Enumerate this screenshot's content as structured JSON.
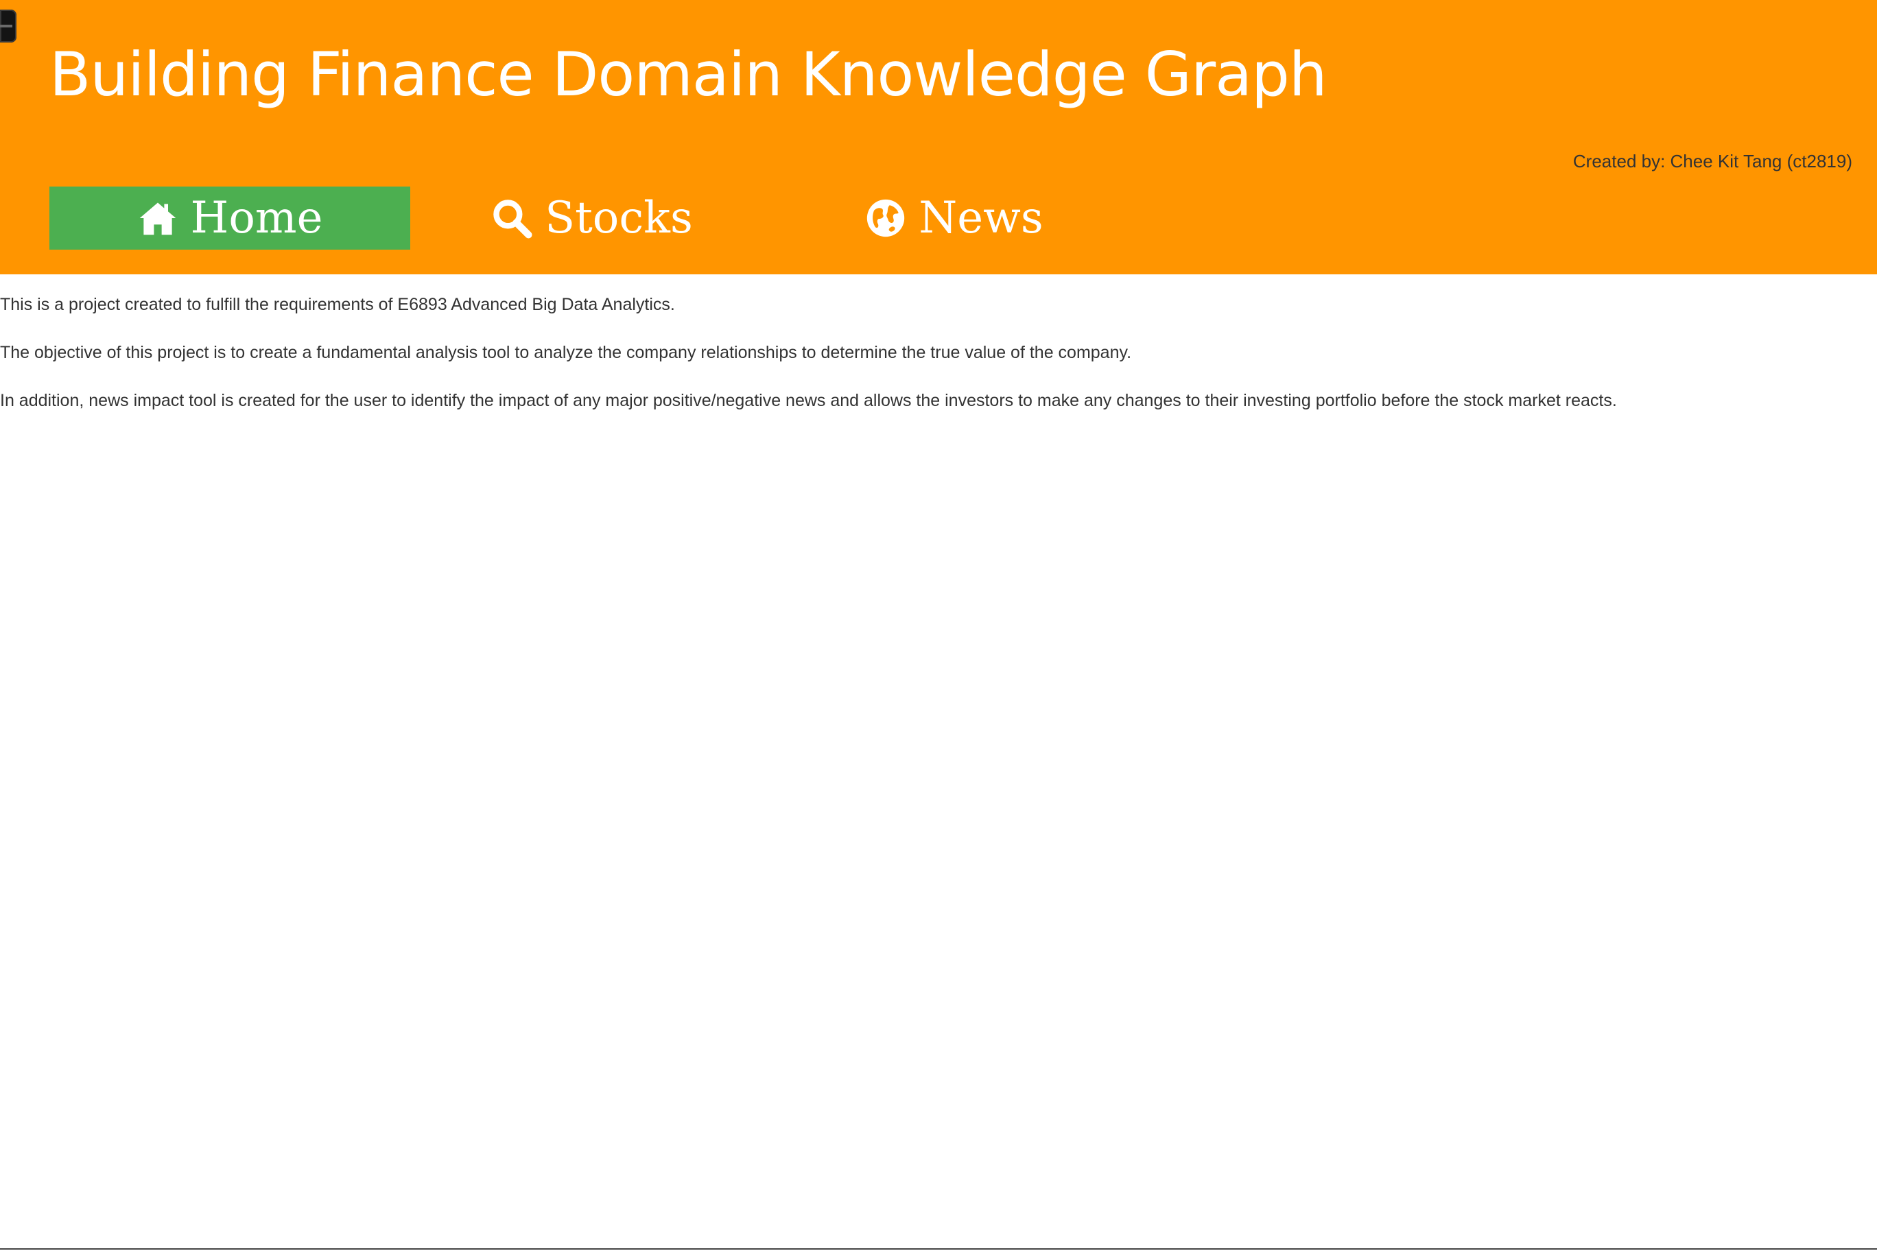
{
  "header": {
    "title": "Building Finance Domain Knowledge Graph",
    "credit": "Created by: Chee Kit Tang (ct2819)",
    "background_color": "#ff9500"
  },
  "nav": {
    "active_color": "#4caf50",
    "items": [
      {
        "label": "Home",
        "icon": "home-icon",
        "active": true
      },
      {
        "label": "Stocks",
        "icon": "search-icon",
        "active": false
      },
      {
        "label": "News",
        "icon": "globe-icon",
        "active": false
      }
    ]
  },
  "content": {
    "paragraphs": [
      "This is a project created to fulfill the requirements of E6893 Advanced Big Data Analytics.",
      "The objective of this project is to create a fundamental analysis tool to analyze the company relationships to determine the true value of the company.",
      "In addition, news impact tool is created for the user to identify the impact of any major positive/negative news and allows the investors to make any changes to their investing portfolio before the stock market reacts."
    ]
  }
}
